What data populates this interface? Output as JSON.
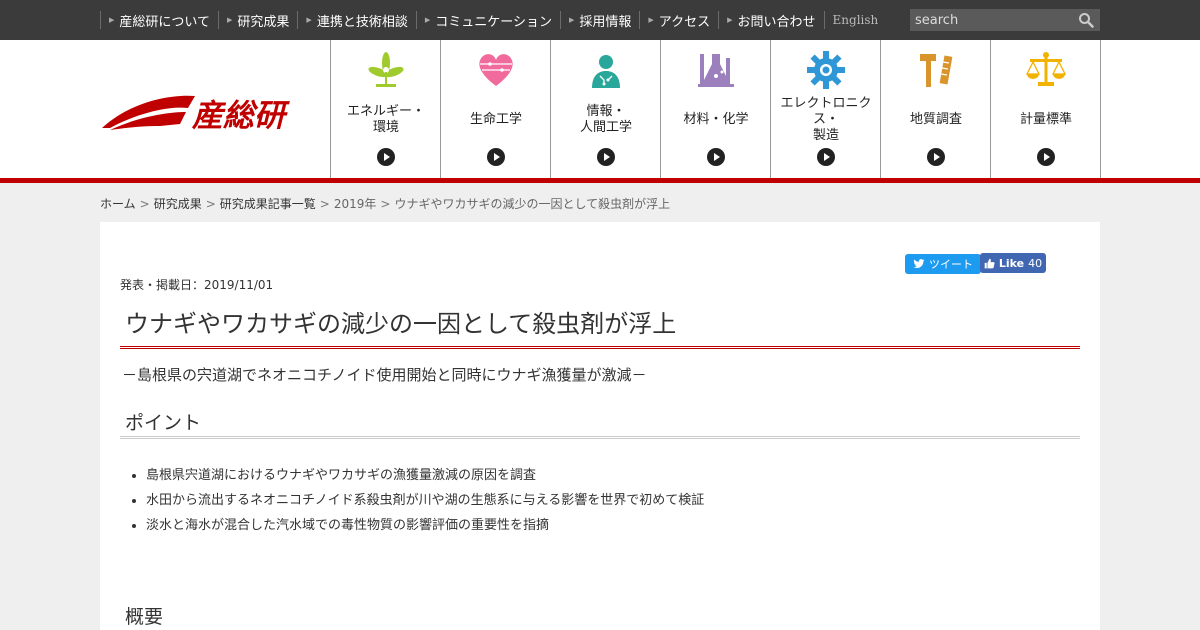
{
  "top_nav": [
    "産総研について",
    "研究成果",
    "連携と技術相談",
    "コミュニケーション",
    "採用情報",
    "アクセス",
    "お問い合わせ"
  ],
  "language_link": "English",
  "search": {
    "placeholder": "search"
  },
  "logo_text": "産総研",
  "categories": [
    {
      "label": "エネルギー・\n環境",
      "icon": "wind-turbine-icon",
      "color": "#9fcb2d"
    },
    {
      "label": "生命工学",
      "icon": "heart-icon",
      "color": "#f06b9b"
    },
    {
      "label": "情報・\n人間工学",
      "icon": "human-circuit-icon",
      "color": "#2aa79b"
    },
    {
      "label": "材料・化学",
      "icon": "flask-icon",
      "color": "#9c7fbd"
    },
    {
      "label": "エレクトロニクス・\n製造",
      "icon": "gear-icon",
      "color": "#2f97d6"
    },
    {
      "label": "地質調査",
      "icon": "hammer-icon",
      "color": "#d9942b"
    },
    {
      "label": "計量標準",
      "icon": "balance-scale-icon",
      "color": "#f2b200"
    }
  ],
  "breadcrumb": [
    "ホーム",
    "研究成果",
    "研究成果記事一覧",
    "2019年",
    "ウナギやワカサギの減少の一因として殺虫剤が浮上"
  ],
  "social": {
    "tweet_label": "ツイート",
    "like_label": "Like",
    "like_count": "40"
  },
  "article": {
    "pubdate": "発表・掲載日：2019/11/01",
    "title": "ウナギやワカサギの減少の一因として殺虫剤が浮上",
    "subtitle": "－島根県の宍道湖でネオニコチノイド使用開始と同時にウナギ漁獲量が激減－",
    "point_heading": "ポイント",
    "points": [
      "島根県宍道湖におけるウナギやワカサギの漁獲量激減の原因を調査",
      "水田から流出するネオニコチノイド系殺虫剤が川や湖の生態系に与える影響を世界で初めて検証",
      "淡水と海水が混合した汽水域での毒性物質の影響評価の重要性を指摘"
    ],
    "overview_heading": "概要"
  },
  "colors": {
    "brand_red": "#c00000",
    "topbar": "#3b3b3b"
  }
}
